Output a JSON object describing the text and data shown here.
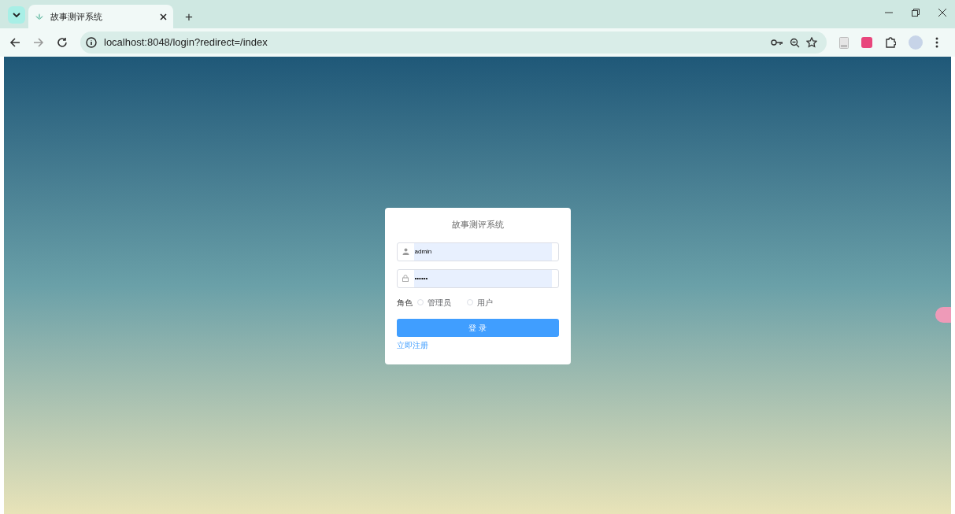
{
  "browser": {
    "tab": {
      "title": "故事测评系统",
      "selected": true
    },
    "new_tab": "+",
    "address": "localhost:8048/login?redirect=/index"
  },
  "login": {
    "title": "故事测评系统",
    "fields": [
      {
        "kind": "user",
        "value": "admin"
      },
      {
        "kind": "lock",
        "value": "••••••"
      }
    ],
    "role_label": "角色",
    "roles": [
      {
        "label": "管理员",
        "selected": false
      },
      {
        "label": "用户",
        "selected": false
      }
    ],
    "submit": "登 录",
    "register_link": "立即注册"
  }
}
